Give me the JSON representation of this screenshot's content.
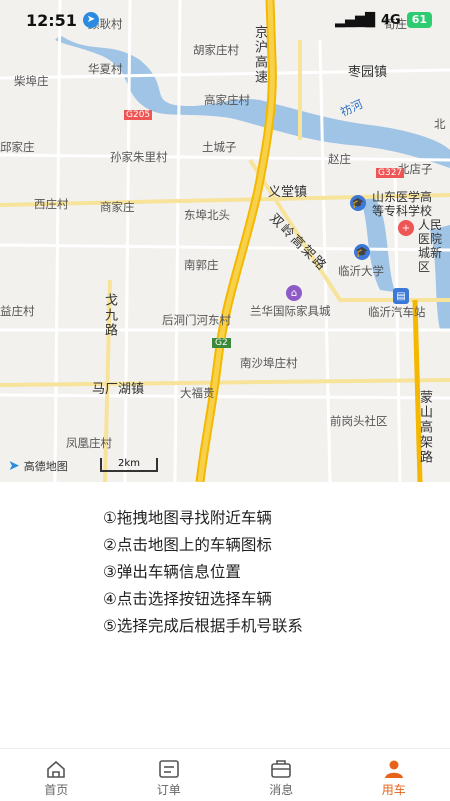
{
  "status_bar": {
    "time": "12:51",
    "network": "4G",
    "battery": "61"
  },
  "map": {
    "places": [
      "颜耿村",
      "胡家庄村",
      "柴埠庄",
      "华夏村",
      "枣园镇",
      "高家庄村",
      "祊河",
      "邱家庄",
      "孙家朱里村",
      "土城子",
      "赵庄",
      "北店子",
      "西庄村",
      "义堂镇",
      "商家庄",
      "东埠北头",
      "南郭庄",
      "临沂大学",
      "益庄村",
      "兰华国际家具城",
      "临沂汽车站",
      "后洞门河东村",
      "南沙埠庄村",
      "马厂湖镇",
      "大福贵",
      "前岗头社区",
      "凤凰庄村",
      "荀庄",
      "北"
    ],
    "pois": [
      "山东医学高等专科学校",
      "人民医院城新区"
    ],
    "roads": [
      "京沪高速",
      "双岭高架路",
      "戈九路",
      "蒙山高架路"
    ],
    "road_codes": [
      "G205",
      "G327",
      "G2"
    ],
    "provider": "高德地图",
    "scale": "2km"
  },
  "instructions": [
    "①拖拽地图寻找附近车辆",
    "②点击地图上的车辆图标",
    "③弹出车辆信息位置",
    "④点击选择按钮选择车辆",
    "⑤选择完成后根据手机号联系"
  ],
  "tabs": [
    {
      "label": "首页",
      "icon": "home-icon",
      "active": false
    },
    {
      "label": "订单",
      "icon": "order-icon",
      "active": false
    },
    {
      "label": "消息",
      "icon": "message-icon",
      "active": false
    },
    {
      "label": "用车",
      "icon": "user-car-icon",
      "active": true
    }
  ],
  "colors": {
    "accent": "#e8631a",
    "highway": "#f5b800",
    "water": "#9fc4e6"
  }
}
